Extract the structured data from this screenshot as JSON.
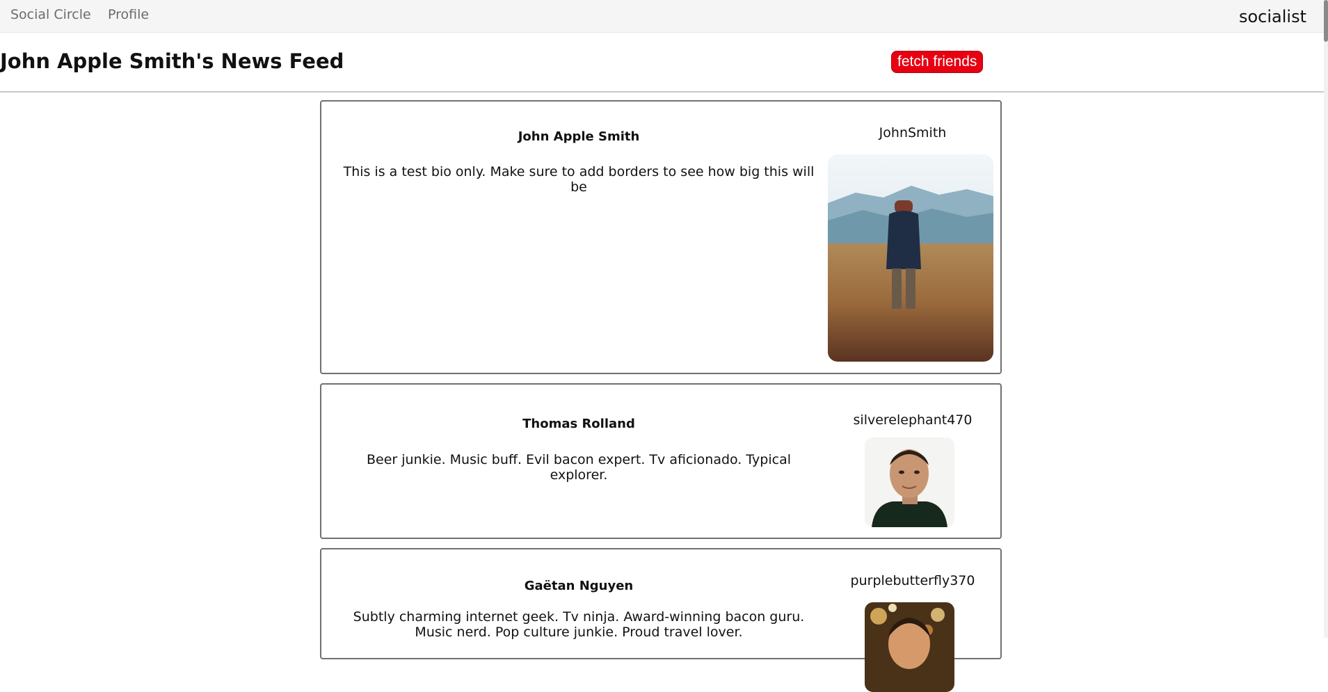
{
  "nav": {
    "links": [
      "Social Circle",
      "Profile"
    ],
    "brand": "socialist"
  },
  "header": {
    "title": "John Apple Smith's News Feed",
    "fetch_button": "fetch friends"
  },
  "colors": {
    "accent": "#e60012",
    "nav_bg": "#f5f5f5",
    "card_border": "#707070"
  },
  "feed": [
    {
      "name": "John Apple Smith",
      "bio": "This is a test bio only. Make sure to add borders to see how big this will be",
      "username": "JohnSmith",
      "avatar_icon": "photo-person-in-field"
    },
    {
      "name": "Thomas Rolland",
      "bio": "Beer junkie. Music buff. Evil bacon expert. Tv aficionado. Typical explorer.",
      "username": "silverelephant470",
      "avatar_icon": "photo-portrait-man"
    },
    {
      "name": "Gaëtan Nguyen",
      "bio": "Subtly charming internet geek. Tv ninja. Award-winning bacon guru. Music nerd. Pop culture junkie. Proud travel lover.",
      "username": "purplebutterfly370",
      "avatar_icon": "photo-bokeh-portrait"
    }
  ]
}
